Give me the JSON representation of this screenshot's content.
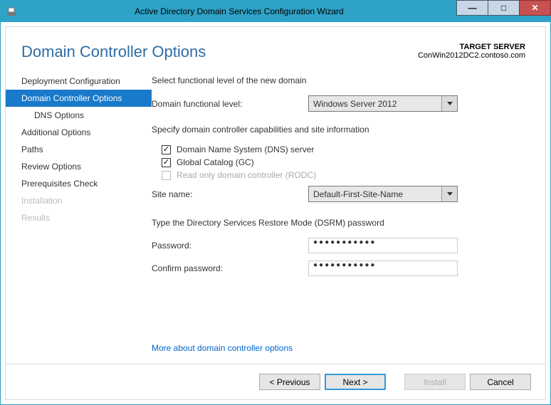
{
  "titlebar": {
    "title": "Active Directory Domain Services Configuration Wizard"
  },
  "header": {
    "page_title": "Domain Controller Options",
    "target_label": "TARGET SERVER",
    "target_server": "ConWin2012DC2.contoso.com"
  },
  "sidebar": {
    "items": [
      {
        "label": "Deployment Configuration"
      },
      {
        "label": "Domain Controller Options"
      },
      {
        "label": "DNS Options"
      },
      {
        "label": "Additional Options"
      },
      {
        "label": "Paths"
      },
      {
        "label": "Review Options"
      },
      {
        "label": "Prerequisites Check"
      },
      {
        "label": "Installation"
      },
      {
        "label": "Results"
      }
    ]
  },
  "main": {
    "section1_label": "Select functional level of the new domain",
    "dfl_label": "Domain functional level:",
    "dfl_value": "Windows Server 2012",
    "section2_label": "Specify domain controller capabilities and site information",
    "cb_dns": "Domain Name System (DNS) server",
    "cb_gc": "Global Catalog (GC)",
    "cb_rodc": "Read only domain controller (RODC)",
    "site_label": "Site name:",
    "site_value": "Default-First-Site-Name",
    "section3_label": "Type the Directory Services Restore Mode (DSRM) password",
    "password_label": "Password:",
    "confirm_label": "Confirm password:",
    "password_mask": "●●●●●●●●●●●",
    "link": "More about domain controller options"
  },
  "footer": {
    "previous": "< Previous",
    "next": "Next >",
    "install": "Install",
    "cancel": "Cancel"
  }
}
